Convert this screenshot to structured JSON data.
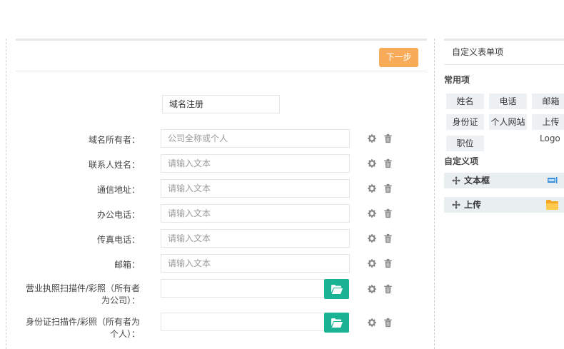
{
  "form": {
    "next_label": "下一步",
    "title_value": "域名注册",
    "rows": [
      {
        "label": "域名所有者：",
        "placeholder": "公司全称或个人"
      },
      {
        "label": "联系人姓名：",
        "placeholder": "请输入文本"
      },
      {
        "label": "通信地址：",
        "placeholder": "请输入文本"
      },
      {
        "label": "办公电话：",
        "placeholder": "请输入文本"
      },
      {
        "label": "传真电话：",
        "placeholder": "请输入文本"
      },
      {
        "label": "邮箱：",
        "placeholder": "请输入文本"
      },
      {
        "label": "营业执照扫描件/彩照（所有者为公司）：",
        "placeholder": ""
      },
      {
        "label": "身份证扫描件/彩照（所有者为个人）：",
        "placeholder": ""
      }
    ]
  },
  "sidebar": {
    "title": "自定义表单项",
    "common_label": "常用项",
    "common_items": [
      "姓名",
      "电话",
      "邮箱",
      "身份证",
      "个人网站",
      "上传",
      "职位"
    ],
    "logo_label": "Logo",
    "custom_label": "自定义项",
    "custom_items": [
      {
        "label": "文本框",
        "icon": "textbox-icon"
      },
      {
        "label": "上传",
        "icon": "folder-icon"
      }
    ]
  },
  "colors": {
    "accent_orange": "#f8ac59",
    "accent_green": "#1ab394",
    "chip_bg": "#eef1f3"
  }
}
